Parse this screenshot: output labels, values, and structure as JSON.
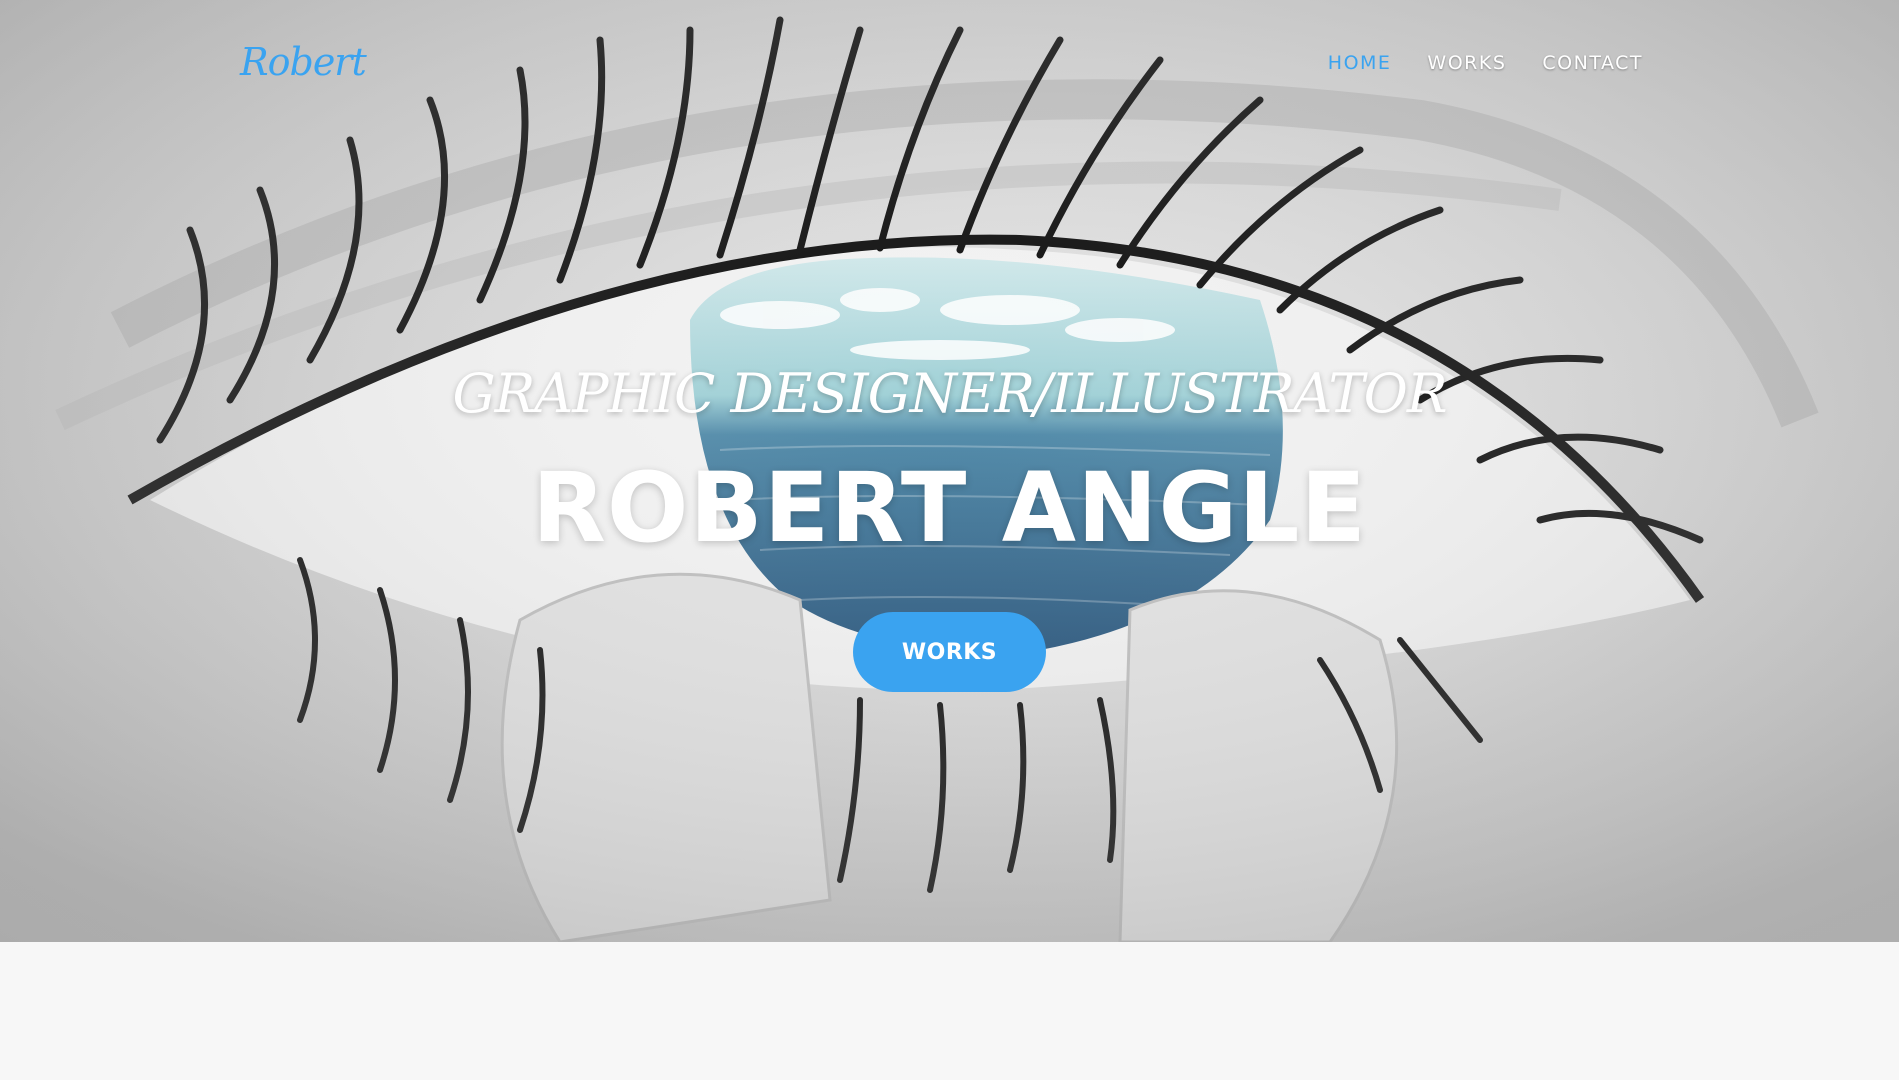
{
  "nav": {
    "brand": "Robert",
    "links": [
      {
        "label": "HOME",
        "active": true
      },
      {
        "label": "WORKS",
        "active": false
      },
      {
        "label": "CONTACT",
        "active": false
      }
    ]
  },
  "hero": {
    "subtitle": "GRAPHIC DESIGNER/ILLUSTRATOR",
    "title": "ROBERT ANGLE",
    "cta_label": "WORKS"
  },
  "colors": {
    "accent": "#3aa3f0",
    "hero_text": "#ffffff",
    "page_background": "#f7f7f7"
  }
}
